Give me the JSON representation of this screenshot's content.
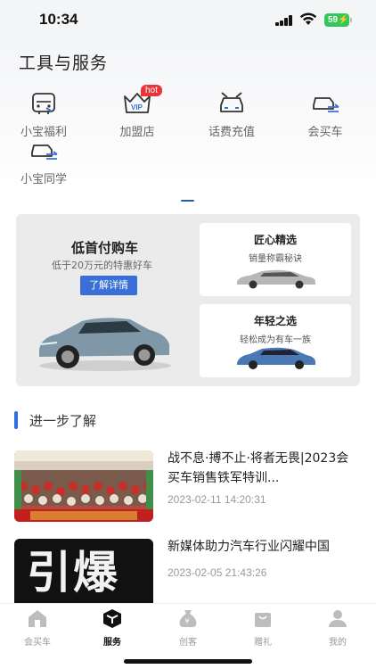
{
  "status": {
    "time": "10:34",
    "battery": "59"
  },
  "tools": {
    "title": "工具与服务",
    "items": [
      {
        "label": "小宝福利",
        "icon": "car-front-icon"
      },
      {
        "label": "加盟店",
        "icon": "vip-crown-icon",
        "badge": "hot"
      },
      {
        "label": "话费充值",
        "icon": "car-roof-icon"
      },
      {
        "label": "会买车",
        "icon": "car-swap-icon"
      },
      {
        "label": "小宝同学",
        "icon": "car-swap-icon"
      }
    ]
  },
  "banner": {
    "title": "低首付购车",
    "subtitle": "低于20万元的特惠好车",
    "button": "了解详情",
    "cards": [
      {
        "title": "匠心精选",
        "subtitle": "销量称霸秘诀"
      },
      {
        "title": "年轻之选",
        "subtitle": "轻松成为有车一族"
      }
    ]
  },
  "learn_more": {
    "title": "进一步了解"
  },
  "news": [
    {
      "title": "战不息·搏不止·将者无畏|2023会买车销售铁军特训...",
      "time": "2023-02-11 14:20:31"
    },
    {
      "title": "新媒体助力汽车行业闪耀中国",
      "time": "2023-02-05 21:43:26",
      "thumb_text": "引爆"
    }
  ],
  "tabbar": {
    "items": [
      {
        "label": "会买车",
        "icon": "home-icon"
      },
      {
        "label": "服务",
        "icon": "cube-icon"
      },
      {
        "label": "创客",
        "icon": "money-bag-icon"
      },
      {
        "label": "赠礼",
        "icon": "gift-bag-icon"
      },
      {
        "label": "我的",
        "icon": "user-icon"
      }
    ],
    "active": "服务"
  },
  "colors": {
    "accent": "#3a6fd8",
    "hot_badge": "#e8343a",
    "battery": "#33c659"
  }
}
